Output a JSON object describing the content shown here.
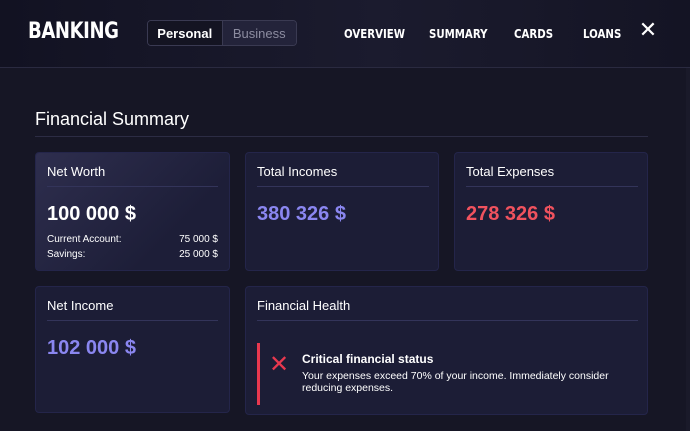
{
  "header": {
    "brand": "BANKING",
    "toggle": {
      "active": "Personal",
      "inactive": "Business"
    },
    "nav": [
      "OVERVIEW",
      "SUMMARY",
      "CARDS",
      "LOANS"
    ],
    "close_icon": "close-icon"
  },
  "summary": {
    "title": "Financial Summary",
    "net_worth": {
      "title": "Net Worth",
      "value": "100 000 $",
      "details": [
        {
          "label": "Current Account:",
          "value": "75 000 $"
        },
        {
          "label": "Savings:",
          "value": "25 000 $"
        }
      ]
    },
    "total_incomes": {
      "title": "Total Incomes",
      "value": "380 326 $"
    },
    "total_expenses": {
      "title": "Total Expenses",
      "value": "278 326 $"
    },
    "net_income": {
      "title": "Net Income",
      "value": "102 000 $"
    },
    "financial_health": {
      "title": "Financial Health",
      "status_icon": "cross-icon",
      "status_title": "Critical financial status",
      "status_text": "Your expenses exceed 70% of your income. Immediately consider reducing expenses."
    }
  },
  "colors": {
    "background": "#161625",
    "card": "#1c1d36",
    "income": "#8a86f0",
    "expense": "#f0525e",
    "alert": "#e8384f"
  }
}
